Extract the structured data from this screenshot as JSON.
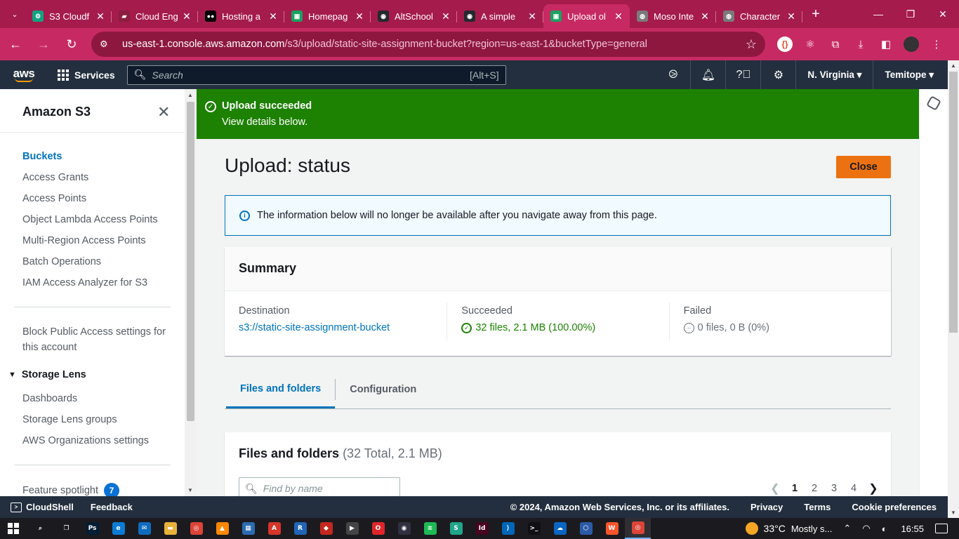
{
  "browser": {
    "tabs": [
      {
        "label": "S3 Cloudf",
        "favicon": "openai-icon",
        "color": "#10a37f",
        "glyph": "⚙"
      },
      {
        "label": "Cloud Eng",
        "favicon": "folder-icon",
        "color": "#8b1e3f",
        "glyph": "▰"
      },
      {
        "label": "Hosting a",
        "favicon": "medium-icon",
        "color": "#000000",
        "glyph": "●●"
      },
      {
        "label": "Homepag",
        "favicon": "page-icon",
        "color": "#1aa260",
        "glyph": "▣"
      },
      {
        "label": "AltSchool",
        "favicon": "github-icon",
        "color": "#24292f",
        "glyph": "◉"
      },
      {
        "label": "A simple",
        "favicon": "github-icon",
        "color": "#24292f",
        "glyph": "◉"
      },
      {
        "label": "Upload ol",
        "favicon": "page-icon",
        "color": "#1aa260",
        "glyph": "▣",
        "active": true
      },
      {
        "label": "Moso Inte",
        "favicon": "globe-icon",
        "color": "#7a7a7a",
        "glyph": "◍"
      },
      {
        "label": "Character",
        "favicon": "globe-icon",
        "color": "#7a7a7a",
        "glyph": "◍"
      }
    ],
    "url_host": "us-east-1.console.aws.amazon.com",
    "url_path": "/s3/upload/static-site-assignment-bucket?region=us-east-1&bucketType=general"
  },
  "awsnav": {
    "logo": "aws",
    "services": "Services",
    "search_placeholder": "Search",
    "search_shortcut": "[Alt+S]",
    "region": "N. Virginia",
    "account": "Temitope"
  },
  "sidebar": {
    "title": "Amazon S3",
    "items": [
      "Buckets",
      "Access Grants",
      "Access Points",
      "Object Lambda Access Points",
      "Multi-Region Access Points",
      "Batch Operations",
      "IAM Access Analyzer for S3"
    ],
    "block_public": "Block Public Access settings for this account",
    "storage_lens": "Storage Lens",
    "lens_items": [
      "Dashboards",
      "Storage Lens groups",
      "AWS Organizations settings"
    ],
    "feature_spotlight": "Feature spotlight",
    "feature_badge": "7"
  },
  "flash": {
    "title": "Upload succeeded",
    "subtitle": "View details below."
  },
  "main": {
    "title": "Upload: status",
    "close": "Close",
    "info": "The information below will no longer be available after you navigate away from this page.",
    "summary": {
      "heading": "Summary",
      "destination_label": "Destination",
      "destination_value": "s3://static-site-assignment-bucket",
      "succeeded_label": "Succeeded",
      "succeeded_value": "32 files, 2.1 MB (100.00%)",
      "failed_label": "Failed",
      "failed_value": "0 files, 0 B (0%)"
    },
    "tabs": [
      "Files and folders",
      "Configuration"
    ],
    "files": {
      "heading": "Files and folders",
      "count": "(32 Total, 2.1 MB)",
      "search_placeholder": "Find by name",
      "pages": [
        "1",
        "2",
        "3",
        "4"
      ]
    }
  },
  "footer": {
    "cloudshell": "CloudShell",
    "feedback": "Feedback",
    "copyright": "© 2024, Amazon Web Services, Inc. or its affiliates.",
    "privacy": "Privacy",
    "terms": "Terms",
    "cookies": "Cookie preferences"
  },
  "taskbar": {
    "weather": "33°C",
    "weather_text": "Mostly s...",
    "time": "16:55",
    "apps": [
      {
        "name": "search-app",
        "color": "#1b1b1f",
        "glyph": "⌕"
      },
      {
        "name": "task-view-app",
        "color": "#1b1b1f",
        "glyph": "❐"
      },
      {
        "name": "photoshop-app",
        "color": "#001e36",
        "glyph": "Ps"
      },
      {
        "name": "edge-app",
        "color": "#0c7bd6",
        "glyph": "e"
      },
      {
        "name": "mail-app",
        "color": "#0f6cbd",
        "glyph": "✉"
      },
      {
        "name": "explorer-app",
        "color": "#e8b23a",
        "glyph": "▬"
      },
      {
        "name": "chrome-app",
        "color": "#db4437",
        "glyph": "◎"
      },
      {
        "name": "vlc-app",
        "color": "#ff8800",
        "glyph": "▲"
      },
      {
        "name": "store-app",
        "color": "#2b6cb0",
        "glyph": "▦"
      },
      {
        "name": "acrobat-app",
        "color": "#d7352a",
        "glyph": "A"
      },
      {
        "name": "r-app",
        "color": "#2165b6",
        "glyph": "R"
      },
      {
        "name": "git-app",
        "color": "#c5271e",
        "glyph": "◆"
      },
      {
        "name": "media-app",
        "color": "#444",
        "glyph": "▶"
      },
      {
        "name": "opera-app",
        "color": "#e0262b",
        "glyph": "O"
      },
      {
        "name": "obs-app",
        "color": "#303040",
        "glyph": "◉"
      },
      {
        "name": "spotify-app",
        "color": "#1db954",
        "glyph": "≋"
      },
      {
        "name": "greenapp-app",
        "color": "#20a58a",
        "glyph": "S"
      },
      {
        "name": "indesign-app",
        "color": "#49021f",
        "glyph": "Id"
      },
      {
        "name": "vscode-app",
        "color": "#0066b8",
        "glyph": "⟩"
      },
      {
        "name": "terminal-app",
        "color": "#101014",
        "glyph": ">_"
      },
      {
        "name": "onedrive-app",
        "color": "#0a66c2",
        "glyph": "☁"
      },
      {
        "name": "virtualbox-app",
        "color": "#2b5aa8",
        "glyph": "⬡"
      },
      {
        "name": "brave-app",
        "color": "#fb542b",
        "glyph": "W"
      },
      {
        "name": "chrome2-app",
        "color": "#db4437",
        "glyph": "◎",
        "active": true
      }
    ]
  }
}
